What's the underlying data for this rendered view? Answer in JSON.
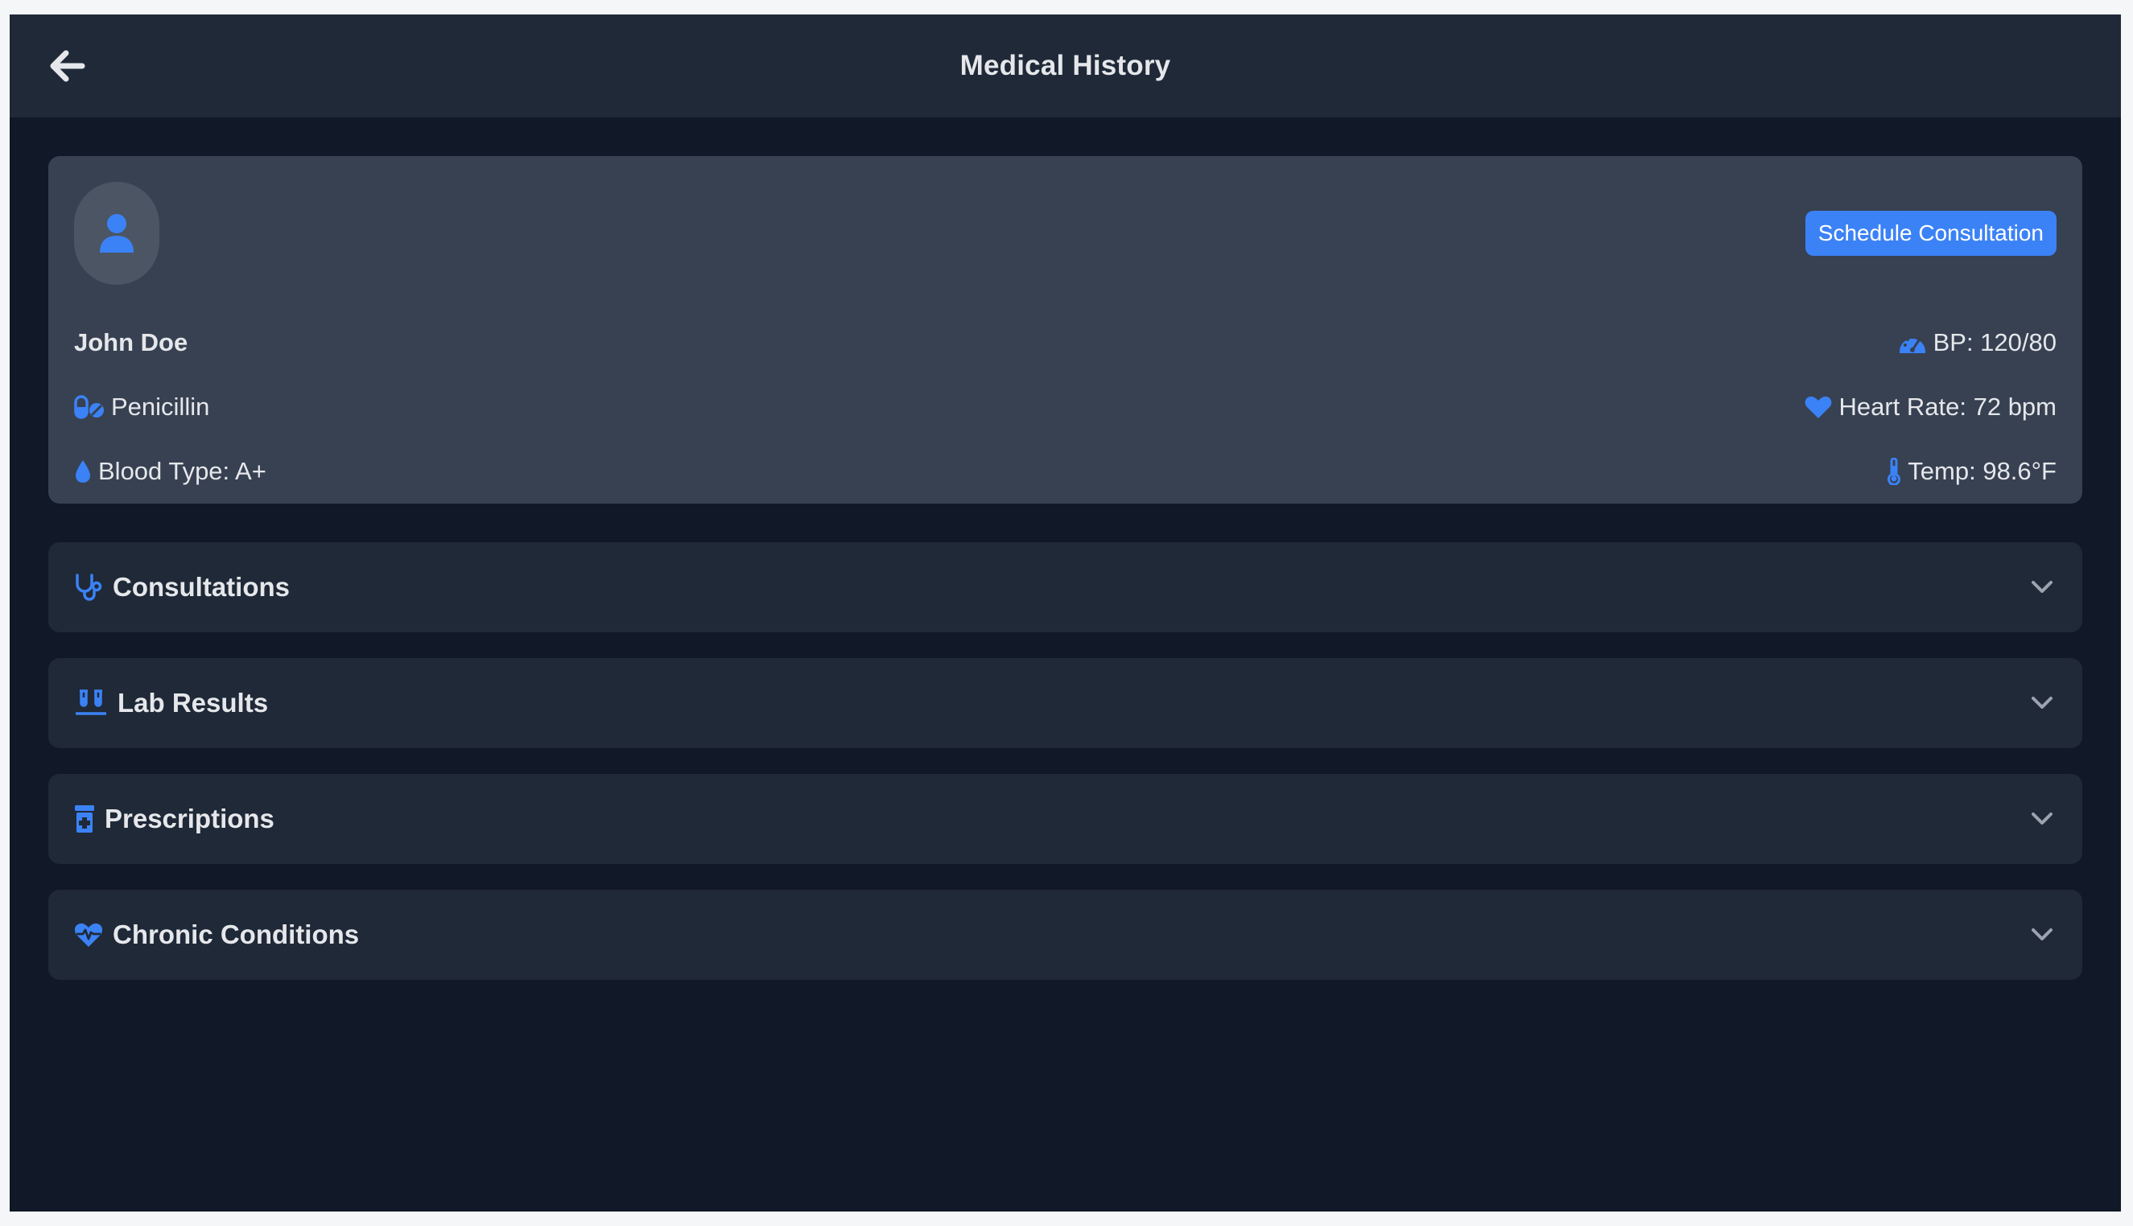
{
  "header": {
    "title": "Medical History",
    "back_icon": "arrow-left-icon"
  },
  "colors": {
    "background": "#111827",
    "surface": "#1f2937",
    "card": "#374151",
    "accent": "#3b82f6",
    "text": "#e5e7eb",
    "muted_icon": "#9ca3af"
  },
  "patient": {
    "name": "John Doe",
    "avatar_icon": "user-icon",
    "schedule_button": "Schedule Consultation",
    "allergy": {
      "icon": "pills-icon",
      "text": "Penicillin"
    },
    "blood_type": {
      "icon": "droplet-icon",
      "text": "Blood Type: A+"
    },
    "vitals": {
      "bp": {
        "icon": "gauge-icon",
        "text": "BP: 120/80"
      },
      "heart_rate": {
        "icon": "heart-icon",
        "text": "Heart Rate: 72 bpm"
      },
      "temp": {
        "icon": "thermometer-icon",
        "text": "Temp: 98.6°F"
      }
    }
  },
  "sections": [
    {
      "label": "Consultations",
      "icon": "stethoscope-icon",
      "chevron": "chevron-down-icon"
    },
    {
      "label": "Lab Results",
      "icon": "test-tubes-icon",
      "chevron": "chevron-down-icon"
    },
    {
      "label": "Prescriptions",
      "icon": "prescription-bottle-icon",
      "chevron": "chevron-down-icon"
    },
    {
      "label": "Chronic Conditions",
      "icon": "heart-pulse-icon",
      "chevron": "chevron-down-icon"
    }
  ]
}
